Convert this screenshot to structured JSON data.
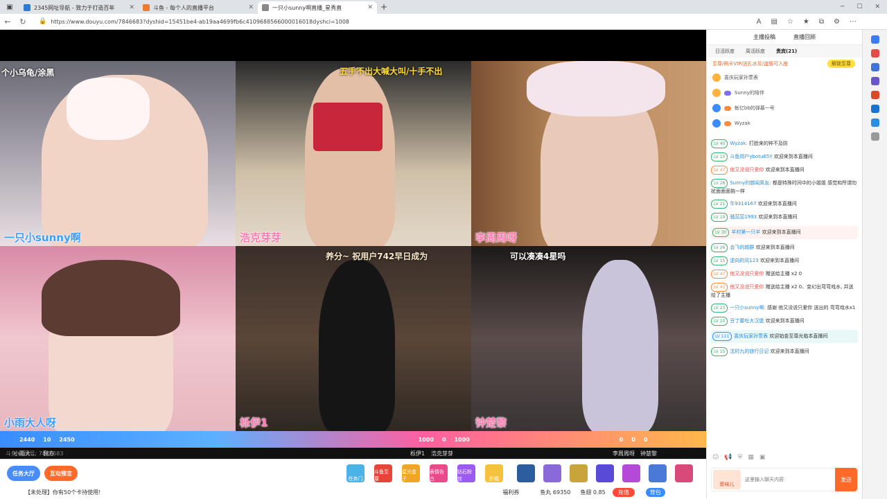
{
  "browser": {
    "tabs": [
      {
        "title": "2345网址导航 - 致力于打造百年",
        "active": false,
        "color": "#2b7bd6"
      },
      {
        "title": "斗鱼 - 每个人的直播平台",
        "active": false,
        "color": "#f07b2f"
      },
      {
        "title": "一只小sunny啊直播_星秀直",
        "active": true,
        "color": "#f07b2f"
      }
    ],
    "url": "https://www.douyu.com/7846683?dyshid=15451be4-ab19aa4699fb6c4109688566000016018dyshci=1008"
  },
  "streams": [
    {
      "name": "一只小sunny啊",
      "overlay": "个小乌龟/涂黑"
    },
    {
      "name": "浩克芽芽",
      "overlay": "五手不出大喊大叫/十手不出"
    },
    {
      "name": "李周周呀",
      "overlay": ""
    },
    {
      "name": "小雨大人呀",
      "overlay": ""
    },
    {
      "name": "栎伊1",
      "overlay": "养分~  祝用户742早日成为"
    },
    {
      "name": "钟楚黎",
      "overlay": "可以凑凑4星吗"
    }
  ],
  "pk": {
    "left_scores": [
      "2440",
      "10",
      "2450"
    ],
    "mid_scores": [
      "1000",
      "0",
      "1000"
    ],
    "right_scores": [
      "0",
      "0",
      "0"
    ],
    "labels": [
      "小雨大...",
      "我方",
      "栎伊1",
      "浩克芽芽",
      "李周周呀",
      "钟楚黎"
    ],
    "timer": "倒计时 06:53",
    "room_id": "斗鱼 房间号: 7846683"
  },
  "bottom": {
    "task_btn": "任务大厅",
    "interact_btn": "互动预言",
    "gifts": [
      "任务门",
      "斗鱼至尊",
      "星光盒子",
      "表情告白",
      "钻石粉丝",
      "折福"
    ],
    "notice": "【未处理】你有50个卡待使用!",
    "welfare": "福利券",
    "fish_balls": "鱼丸 69350",
    "fish_wings": "鱼翅 0.85",
    "recharge": "充值",
    "backpack": "背包"
  },
  "chat": {
    "head_left": "主播投稿",
    "head_right": "直播回顾",
    "tabs": [
      "日活跃度",
      "周活跃度",
      "贵宾(21)"
    ],
    "vip_text": "至尊/刷卡VIP/送礼水反/盗版可入座",
    "vip_btn": "解锁至尊",
    "rank": [
      {
        "name": "喜庆玩家孙萱表"
      },
      {
        "name": "Sunny的陪伴"
      },
      {
        "name": "帐亿bb的弹幕一号"
      },
      {
        "name": "Wyzak"
      }
    ],
    "messages": [
      {
        "lv": "LV 40",
        "user": "Wyzak:",
        "text": "打脸来的猝不及防",
        "type": "normal"
      },
      {
        "lv": "LV 10",
        "user": "斗鱼用户ybotu65Y",
        "text": "欢迎来到本直播间",
        "type": "normal"
      },
      {
        "lv": "LV 47",
        "user": "他又没说只爱你",
        "text": "欢迎来到本直播间",
        "type": "red"
      },
      {
        "lv": "LV 28",
        "user": "Sunny的御闺男友:",
        "text": "都是特殊时间中的小姐姐 感觉和所谓勿扰面面面挑一样",
        "type": "normal"
      },
      {
        "lv": "LV 21",
        "user": "牛9314167",
        "text": "欢迎来到本直播间",
        "type": "normal"
      },
      {
        "lv": "LV 19",
        "user": "骚蕊蕊1993",
        "text": "欢迎来到本直播间",
        "type": "normal"
      },
      {
        "lv": "LV 30",
        "user": "羊村第一只羊",
        "text": "欢迎来到本直播间",
        "type": "pink"
      },
      {
        "lv": "LV 26",
        "user": "会飞的超群",
        "text": "欢迎来到本直播间",
        "type": "normal"
      },
      {
        "lv": "LV 15",
        "user": "逆向的风123",
        "text": "欢迎来到本直播间",
        "type": "normal"
      },
      {
        "lv": "LV 47",
        "user": "他又没说只爱你",
        "text": "赠送给主播 x2 0",
        "type": "red"
      },
      {
        "lv": "LV 47",
        "user": "他又没说只爱你",
        "text": "赠送给主播 x2 0、变幻出弯弯戏水, 并送给了主播",
        "type": "red"
      },
      {
        "lv": "LV 23",
        "user": "一只小sunny啊:",
        "text": "感谢 他又没说只爱你 送出的 弯弯戏水x1",
        "type": "normal"
      },
      {
        "lv": "LV 10",
        "user": "豆丁要吃大汉堡",
        "text": "欢迎来到本直播间",
        "type": "normal"
      },
      {
        "lv": "LV 111",
        "user": "喜庆玩家孙萱表",
        "text": "欢迎铂金至尊光临本直播间",
        "type": "hl"
      },
      {
        "lv": "LV 15",
        "user": "沈时九的旅行日记",
        "text": "欢迎来到本直播间",
        "type": "normal"
      }
    ],
    "input_placeholder": "这里输入聊天内容",
    "fan_label": "聚味儿",
    "send": "发送"
  }
}
